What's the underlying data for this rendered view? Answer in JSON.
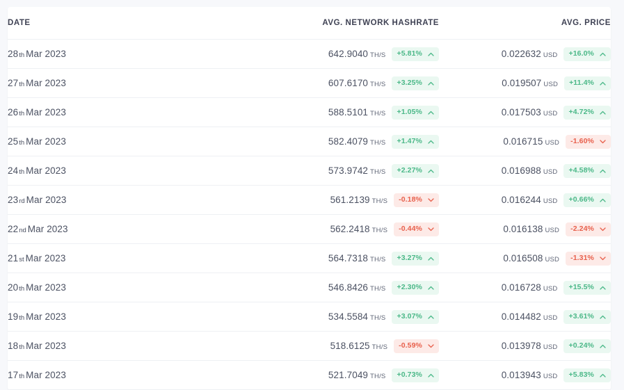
{
  "table": {
    "columns": [
      {
        "key": "date",
        "label": "DATE"
      },
      {
        "key": "hash",
        "label": "AVG. NETWORK HASHRATE"
      },
      {
        "key": "price",
        "label": "AVG. PRICE"
      }
    ],
    "units": {
      "hashrate": "TH/s",
      "price": "USD"
    },
    "icons": {
      "up": "chevron-up-icon",
      "down": "chevron-down-icon"
    },
    "colors": {
      "positive_text": "#4bb888",
      "positive_bg": "#eaf8f1",
      "negative_text": "#e8604c",
      "negative_bg": "#fdeae7",
      "value_text": "#4b5162",
      "header_text": "#3f4254",
      "page_bg": "#f7f8fb",
      "card_bg": "#ffffff",
      "row_border": "#eef0f4"
    },
    "rows": [
      {
        "date_day": "28",
        "date_ord": "th",
        "date_rest": "Mar 2023",
        "hashrate": "642.9040",
        "hashrate_unit": "TH/s",
        "hashrate_change": "+5.81%",
        "hashrate_dir": "up",
        "price": "0.022632",
        "price_unit": "USD",
        "price_change": "+16.0%",
        "price_dir": "up"
      },
      {
        "date_day": "27",
        "date_ord": "th",
        "date_rest": "Mar 2023",
        "hashrate": "607.6170",
        "hashrate_unit": "TH/s",
        "hashrate_change": "+3.25%",
        "hashrate_dir": "up",
        "price": "0.019507",
        "price_unit": "USD",
        "price_change": "+11.4%",
        "price_dir": "up"
      },
      {
        "date_day": "26",
        "date_ord": "th",
        "date_rest": "Mar 2023",
        "hashrate": "588.5101",
        "hashrate_unit": "TH/s",
        "hashrate_change": "+1.05%",
        "hashrate_dir": "up",
        "price": "0.017503",
        "price_unit": "USD",
        "price_change": "+4.72%",
        "price_dir": "up"
      },
      {
        "date_day": "25",
        "date_ord": "th",
        "date_rest": "Mar 2023",
        "hashrate": "582.4079",
        "hashrate_unit": "TH/s",
        "hashrate_change": "+1.47%",
        "hashrate_dir": "up",
        "price": "0.016715",
        "price_unit": "USD",
        "price_change": "-1.60%",
        "price_dir": "down"
      },
      {
        "date_day": "24",
        "date_ord": "th",
        "date_rest": "Mar 2023",
        "hashrate": "573.9742",
        "hashrate_unit": "TH/s",
        "hashrate_change": "+2.27%",
        "hashrate_dir": "up",
        "price": "0.016988",
        "price_unit": "USD",
        "price_change": "+4.58%",
        "price_dir": "up"
      },
      {
        "date_day": "23",
        "date_ord": "rd",
        "date_rest": "Mar 2023",
        "hashrate": "561.2139",
        "hashrate_unit": "TH/s",
        "hashrate_change": "-0.18%",
        "hashrate_dir": "down",
        "price": "0.016244",
        "price_unit": "USD",
        "price_change": "+0.66%",
        "price_dir": "up"
      },
      {
        "date_day": "22",
        "date_ord": "nd",
        "date_rest": "Mar 2023",
        "hashrate": "562.2418",
        "hashrate_unit": "TH/s",
        "hashrate_change": "-0.44%",
        "hashrate_dir": "down",
        "price": "0.016138",
        "price_unit": "USD",
        "price_change": "-2.24%",
        "price_dir": "down"
      },
      {
        "date_day": "21",
        "date_ord": "st",
        "date_rest": "Mar 2023",
        "hashrate": "564.7318",
        "hashrate_unit": "TH/s",
        "hashrate_change": "+3.27%",
        "hashrate_dir": "up",
        "price": "0.016508",
        "price_unit": "USD",
        "price_change": "-1.31%",
        "price_dir": "down"
      },
      {
        "date_day": "20",
        "date_ord": "th",
        "date_rest": "Mar 2023",
        "hashrate": "546.8426",
        "hashrate_unit": "TH/s",
        "hashrate_change": "+2.30%",
        "hashrate_dir": "up",
        "price": "0.016728",
        "price_unit": "USD",
        "price_change": "+15.5%",
        "price_dir": "up"
      },
      {
        "date_day": "19",
        "date_ord": "th",
        "date_rest": "Mar 2023",
        "hashrate": "534.5584",
        "hashrate_unit": "TH/s",
        "hashrate_change": "+3.07%",
        "hashrate_dir": "up",
        "price": "0.014482",
        "price_unit": "USD",
        "price_change": "+3.61%",
        "price_dir": "up"
      },
      {
        "date_day": "18",
        "date_ord": "th",
        "date_rest": "Mar 2023",
        "hashrate": "518.6125",
        "hashrate_unit": "TH/s",
        "hashrate_change": "-0.59%",
        "hashrate_dir": "down",
        "price": "0.013978",
        "price_unit": "USD",
        "price_change": "+0.24%",
        "price_dir": "up"
      },
      {
        "date_day": "17",
        "date_ord": "th",
        "date_rest": "Mar 2023",
        "hashrate": "521.7049",
        "hashrate_unit": "TH/s",
        "hashrate_change": "+0.73%",
        "hashrate_dir": "up",
        "price": "0.013943",
        "price_unit": "USD",
        "price_change": "+5.83%",
        "price_dir": "up"
      }
    ]
  }
}
